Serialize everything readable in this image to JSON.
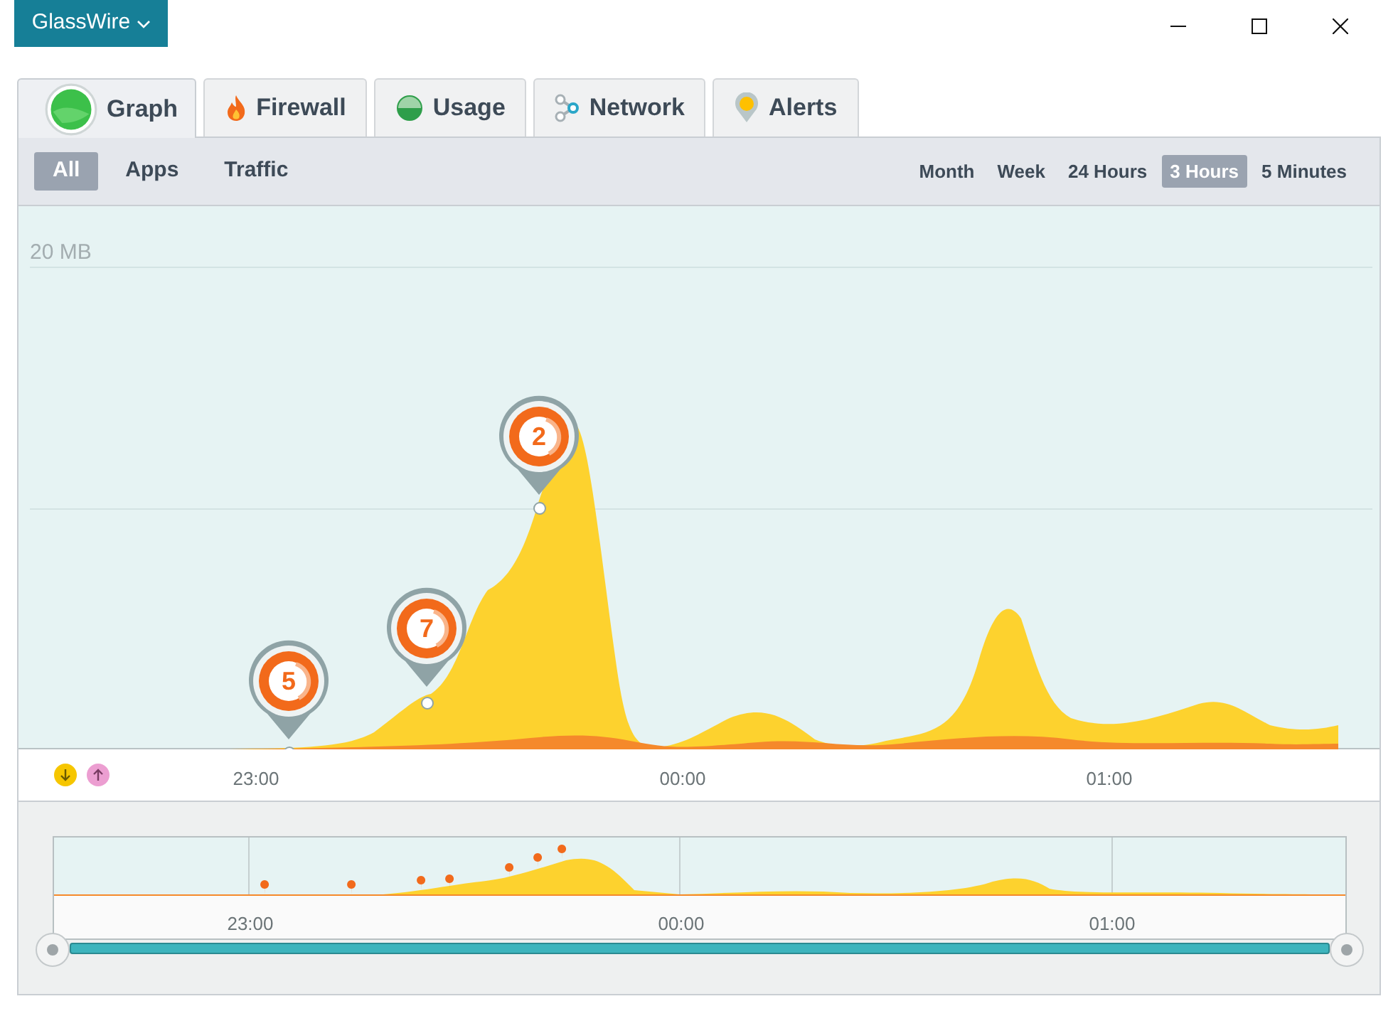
{
  "app_menu": {
    "label": "GlassWire"
  },
  "tabs": [
    {
      "label": "Graph",
      "selected": true,
      "kind": "graph"
    },
    {
      "label": "Firewall",
      "selected": false,
      "kind": "firewall"
    },
    {
      "label": "Usage",
      "selected": false,
      "kind": "usage"
    },
    {
      "label": "Network",
      "selected": false,
      "kind": "network"
    },
    {
      "label": "Alerts",
      "selected": false,
      "kind": "alerts"
    }
  ],
  "filters": [
    {
      "label": "All",
      "selected": true
    },
    {
      "label": "Apps",
      "selected": false
    },
    {
      "label": "Traffic",
      "selected": false
    }
  ],
  "ranges": [
    {
      "label": "Month",
      "selected": false
    },
    {
      "label": "Week",
      "selected": false
    },
    {
      "label": "24 Hours",
      "selected": false
    },
    {
      "label": "3 Hours",
      "selected": true
    },
    {
      "label": "5 Minutes",
      "selected": false
    }
  ],
  "graph": {
    "y_label": "20 MB",
    "alerts": [
      {
        "count": "5"
      },
      {
        "count": "7"
      },
      {
        "count": "2"
      }
    ],
    "time_labels": [
      "23:00",
      "00:00",
      "01:00"
    ]
  },
  "overview": {
    "time_labels": [
      "23:00",
      "00:00",
      "01:00"
    ]
  }
}
